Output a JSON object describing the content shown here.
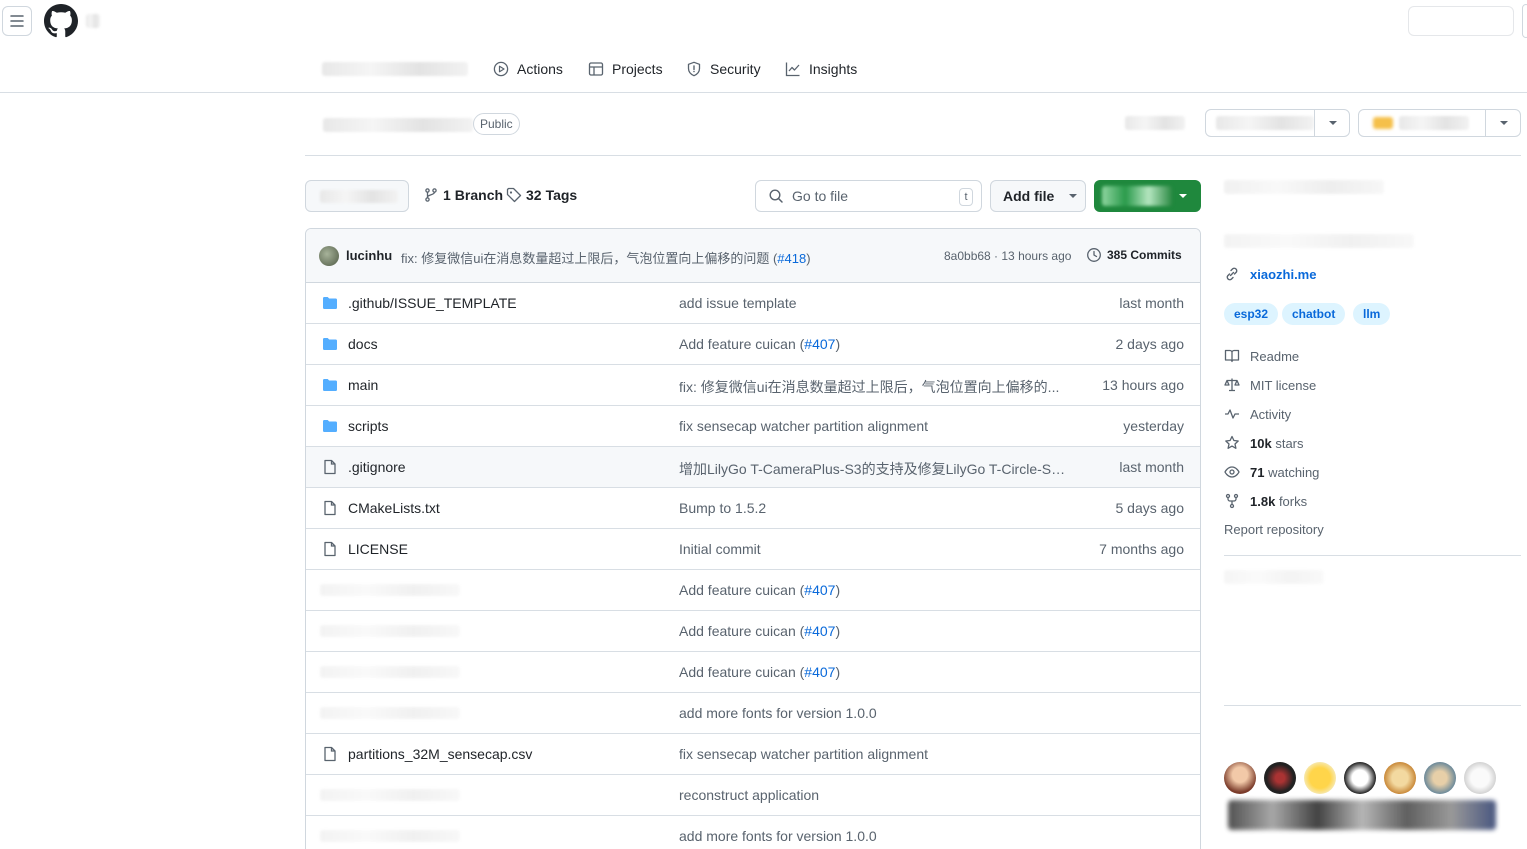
{
  "nav": {
    "tabs": [
      {
        "label": "Actions",
        "icon": "play-icon"
      },
      {
        "label": "Projects",
        "icon": "table-icon"
      },
      {
        "label": "Security",
        "icon": "shield-icon"
      },
      {
        "label": "Insights",
        "icon": "graph-icon"
      }
    ]
  },
  "repo": {
    "visibility": "Public"
  },
  "toolbar": {
    "branches_count": "1",
    "branches_label": "Branch",
    "tags_count": "32",
    "tags_label": "Tags",
    "goto_placeholder": "Go to file",
    "goto_shortcut": "t",
    "add_file_label": "Add file"
  },
  "latest_commit": {
    "author": "lucinhu",
    "message": "fix: 修复微信ui在消息数量超过上限后，气泡位置向上偏移的问题 (",
    "pr_link": "#418",
    "message_tail": ")",
    "sha_time": "8a0bb68 · 13 hours ago",
    "commits_label": "385 Commits"
  },
  "files": [
    {
      "type": "folder",
      "name": ".github/ISSUE_TEMPLATE",
      "message": "add issue template",
      "pr": "",
      "date": "last month"
    },
    {
      "type": "folder",
      "name": "docs",
      "message": "Add feature cuican (",
      "pr": "#407",
      "date": "2 days ago"
    },
    {
      "type": "folder",
      "name": "main",
      "message": "fix: 修复微信ui在消息数量超过上限后，气泡位置向上偏移的...",
      "pr": "",
      "date": "13 hours ago"
    },
    {
      "type": "folder",
      "name": "scripts",
      "message": "fix sensecap watcher partition alignment",
      "pr": "",
      "date": "yesterday"
    },
    {
      "type": "file",
      "name": ".gitignore",
      "message": "增加LilyGo T-CameraPlus-S3的支持及修复LilyGo T-Circle-S3...",
      "pr": "",
      "date": "last month"
    },
    {
      "type": "file",
      "name": "CMakeLists.txt",
      "message": "Bump to 1.5.2",
      "pr": "",
      "date": "5 days ago"
    },
    {
      "type": "file",
      "name": "LICENSE",
      "message": "Initial commit",
      "pr": "",
      "date": "7 months ago"
    },
    {
      "type": "hidden",
      "name": "",
      "message": "Add feature cuican (",
      "pr": "#407",
      "date": ""
    },
    {
      "type": "hidden",
      "name": "",
      "message": "Add feature cuican (",
      "pr": "#407",
      "date": ""
    },
    {
      "type": "hidden",
      "name": "",
      "message": "Add feature cuican (",
      "pr": "#407",
      "date": ""
    },
    {
      "type": "hidden",
      "name": "",
      "message": "add more fonts for version 1.0.0",
      "pr": "",
      "date": ""
    },
    {
      "type": "file",
      "name": "partitions_32M_sensecap.csv",
      "message": "fix sensecap watcher partition alignment",
      "pr": "",
      "date": ""
    },
    {
      "type": "hidden",
      "name": "",
      "message": "reconstruct application",
      "pr": "",
      "date": ""
    },
    {
      "type": "hidden",
      "name": "",
      "message": "add more fonts for version 1.0.0",
      "pr": "",
      "date": ""
    }
  ],
  "sidebar": {
    "website": "xiaozhi.me",
    "topics": [
      "esp32",
      "chatbot",
      "llm"
    ],
    "readme": "Readme",
    "license": "MIT license",
    "activity": "Activity",
    "stars_count": "10k",
    "stars_label": "stars",
    "watching_count": "71",
    "watching_label": "watching",
    "forks_count": "1.8k",
    "forks_label": "forks",
    "report": "Report repository"
  },
  "colors": {
    "link": "#0969da",
    "primary_button": "#1f883d",
    "folder": "#54aeff",
    "muted_text": "#59636e"
  }
}
